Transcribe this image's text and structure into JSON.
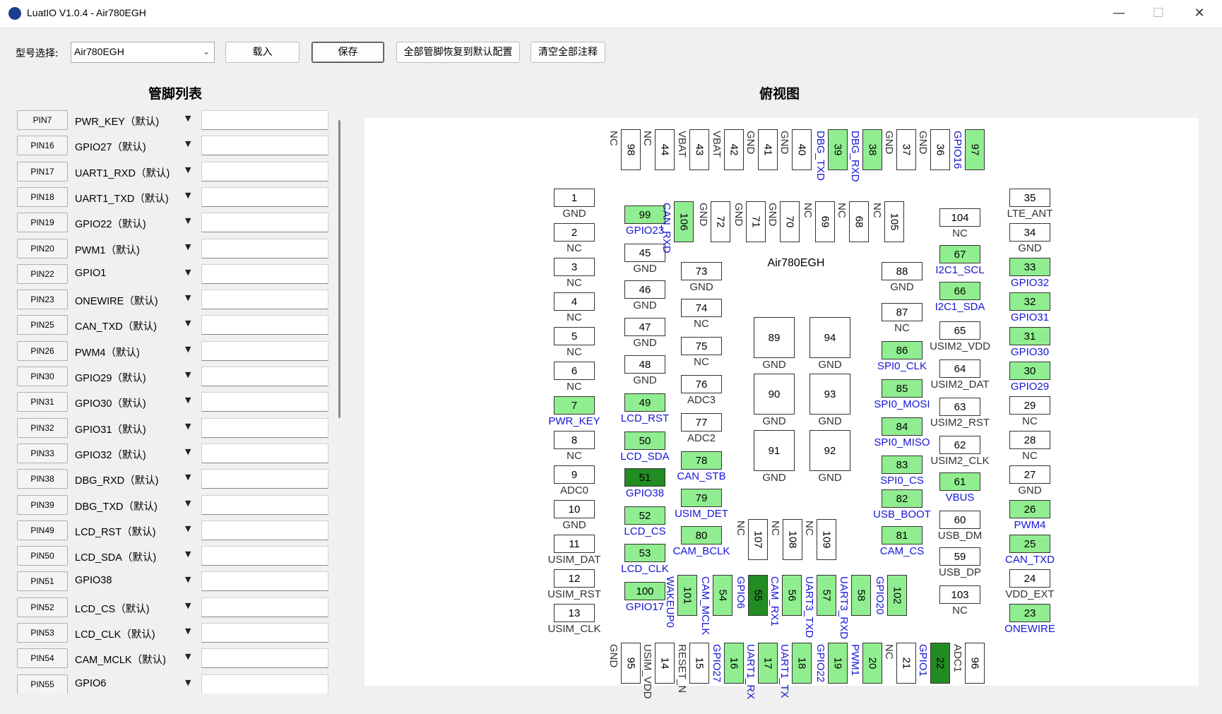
{
  "window": {
    "title": "LuatIO V1.0.4 - Air780EGH",
    "logo_text": "LuatIO"
  },
  "toolbar": {
    "model_label": "型号选择:",
    "model_value": "Air780EGH",
    "load_label": "载入",
    "save_label": "保存",
    "reset_label": "全部管脚恢复到默认配置",
    "clear_label": "清空全部注释"
  },
  "pin_list_title": "管脚列表",
  "top_view_title": "俯视图",
  "chip_name": "Air780EGH",
  "pins": [
    {
      "pin": "PIN7",
      "func": "PWR_KEY（默认)"
    },
    {
      "pin": "PIN16",
      "func": "GPIO27（默认)"
    },
    {
      "pin": "PIN17",
      "func": "UART1_RXD（默认)"
    },
    {
      "pin": "PIN18",
      "func": "UART1_TXD（默认)"
    },
    {
      "pin": "PIN19",
      "func": "GPIO22（默认)"
    },
    {
      "pin": "PIN20",
      "func": "PWM1（默认)"
    },
    {
      "pin": "PIN22",
      "func": "GPIO1"
    },
    {
      "pin": "PIN23",
      "func": "ONEWIRE（默认)"
    },
    {
      "pin": "PIN25",
      "func": "CAN_TXD（默认)"
    },
    {
      "pin": "PIN26",
      "func": "PWM4（默认)"
    },
    {
      "pin": "PIN30",
      "func": "GPIO29（默认)"
    },
    {
      "pin": "PIN31",
      "func": "GPIO30（默认)"
    },
    {
      "pin": "PIN32",
      "func": "GPIO31（默认)"
    },
    {
      "pin": "PIN33",
      "func": "GPIO32（默认)"
    },
    {
      "pin": "PIN38",
      "func": "DBG_RXD（默认)"
    },
    {
      "pin": "PIN39",
      "func": "DBG_TXD（默认)"
    },
    {
      "pin": "PIN49",
      "func": "LCD_RST（默认)"
    },
    {
      "pin": "PIN50",
      "func": "LCD_SDA（默认)"
    },
    {
      "pin": "PIN51",
      "func": "GPIO38"
    },
    {
      "pin": "PIN52",
      "func": "LCD_CS（默认)"
    },
    {
      "pin": "PIN53",
      "func": "LCD_CLK（默认)"
    },
    {
      "pin": "PIN54",
      "func": "CAM_MCLK（默认)"
    },
    {
      "pin": "PIN55",
      "func": "GPIO6"
    }
  ],
  "left_pads": [
    {
      "n": "1",
      "l": "GND",
      "s": ""
    },
    {
      "n": "2",
      "l": "NC",
      "s": ""
    },
    {
      "n": "3",
      "l": "NC",
      "s": ""
    },
    {
      "n": "4",
      "l": "NC",
      "s": ""
    },
    {
      "n": "5",
      "l": "NC",
      "s": ""
    },
    {
      "n": "6",
      "l": "NC",
      "s": ""
    },
    {
      "n": "7",
      "l": "PWR_KEY",
      "s": "green"
    },
    {
      "n": "8",
      "l": "NC",
      "s": ""
    },
    {
      "n": "9",
      "l": "ADC0",
      "s": ""
    },
    {
      "n": "10",
      "l": "GND",
      "s": ""
    },
    {
      "n": "11",
      "l": "USIM_DAT",
      "s": ""
    },
    {
      "n": "12",
      "l": "USIM_RST",
      "s": ""
    },
    {
      "n": "13",
      "l": "USIM_CLK",
      "s": ""
    }
  ],
  "inner_left_pads": [
    {
      "n": "99",
      "l": "GPIO23",
      "s": "green"
    },
    {
      "n": "45",
      "l": "GND",
      "s": ""
    },
    {
      "n": "46",
      "l": "GND",
      "s": ""
    },
    {
      "n": "47",
      "l": "GND",
      "s": ""
    },
    {
      "n": "48",
      "l": "GND",
      "s": ""
    },
    {
      "n": "49",
      "l": "LCD_RST",
      "s": "green"
    },
    {
      "n": "50",
      "l": "LCD_SDA",
      "s": "green"
    },
    {
      "n": "51",
      "l": "GPIO38",
      "s": "dark"
    },
    {
      "n": "52",
      "l": "LCD_CS",
      "s": "green"
    },
    {
      "n": "53",
      "l": "LCD_CLK",
      "s": "green"
    },
    {
      "n": "100",
      "l": "GPIO17",
      "s": "green"
    }
  ],
  "mid_left_pads": [
    {
      "n": "73",
      "l": "GND",
      "s": ""
    },
    {
      "n": "74",
      "l": "NC",
      "s": ""
    },
    {
      "n": "75",
      "l": "NC",
      "s": ""
    },
    {
      "n": "76",
      "l": "ADC3",
      "s": ""
    },
    {
      "n": "77",
      "l": "ADC2",
      "s": ""
    },
    {
      "n": "78",
      "l": "CAN_STB",
      "s": "green"
    },
    {
      "n": "79",
      "l": "USIM_DET",
      "s": "green"
    },
    {
      "n": "80",
      "l": "CAM_BCLK",
      "s": "green"
    }
  ],
  "mid_right_pads": [
    {
      "n": "88",
      "l": "GND",
      "s": ""
    },
    {
      "n": "87",
      "l": "NC",
      "s": ""
    },
    {
      "n": "86",
      "l": "SPI0_CLK",
      "s": "green"
    },
    {
      "n": "85",
      "l": "SPI0_MOSI",
      "s": "green"
    },
    {
      "n": "84",
      "l": "SPI0_MISO",
      "s": "green"
    },
    {
      "n": "83",
      "l": "SPI0_CS",
      "s": "green"
    },
    {
      "n": "82",
      "l": "USB_BOOT",
      "s": "green"
    },
    {
      "n": "81",
      "l": "CAM_CS",
      "s": "green"
    }
  ],
  "inner_right_pads": [
    {
      "n": "104",
      "l": "NC",
      "s": ""
    },
    {
      "n": "67",
      "l": "I2C1_SCL",
      "s": "green"
    },
    {
      "n": "66",
      "l": "I2C1_SDA",
      "s": "green"
    },
    {
      "n": "65",
      "l": "USIM2_VDD",
      "s": ""
    },
    {
      "n": "64",
      "l": "USIM2_DAT",
      "s": ""
    },
    {
      "n": "63",
      "l": "USIM2_RST",
      "s": ""
    },
    {
      "n": "62",
      "l": "USIM2_CLK",
      "s": ""
    },
    {
      "n": "61",
      "l": "VBUS",
      "s": "green"
    },
    {
      "n": "60",
      "l": "USB_DM",
      "s": ""
    },
    {
      "n": "59",
      "l": "USB_DP",
      "s": ""
    },
    {
      "n": "103",
      "l": "NC",
      "s": ""
    }
  ],
  "right_pads": [
    {
      "n": "35",
      "l": "LTE_ANT",
      "s": ""
    },
    {
      "n": "34",
      "l": "GND",
      "s": ""
    },
    {
      "n": "33",
      "l": "GPIO32",
      "s": "green"
    },
    {
      "n": "32",
      "l": "GPIO31",
      "s": "green"
    },
    {
      "n": "31",
      "l": "GPIO30",
      "s": "green"
    },
    {
      "n": "30",
      "l": "GPIO29",
      "s": "green"
    },
    {
      "n": "29",
      "l": "NC",
      "s": ""
    },
    {
      "n": "28",
      "l": "NC",
      "s": ""
    },
    {
      "n": "27",
      "l": "GND",
      "s": ""
    },
    {
      "n": "26",
      "l": "PWM4",
      "s": "green"
    },
    {
      "n": "25",
      "l": "CAN_TXD",
      "s": "green"
    },
    {
      "n": "24",
      "l": "VDD_EXT",
      "s": ""
    },
    {
      "n": "23",
      "l": "ONEWIRE",
      "s": "green"
    }
  ],
  "top_pads": [
    {
      "n": "98",
      "l": "NC",
      "s": ""
    },
    {
      "n": "44",
      "l": "NC",
      "s": ""
    },
    {
      "n": "43",
      "l": "VBAT",
      "s": ""
    },
    {
      "n": "42",
      "l": "VBAT",
      "s": ""
    },
    {
      "n": "41",
      "l": "GND",
      "s": ""
    },
    {
      "n": "40",
      "l": "GND",
      "s": ""
    },
    {
      "n": "39",
      "l": "DBG_TXD",
      "s": "green"
    },
    {
      "n": "38",
      "l": "DBG_RXD",
      "s": "green"
    },
    {
      "n": "37",
      "l": "GND",
      "s": ""
    },
    {
      "n": "36",
      "l": "GND",
      "s": ""
    },
    {
      "n": "97",
      "l": "GPIO16",
      "s": "green"
    }
  ],
  "inner_top_pads": [
    {
      "n": "106",
      "l": "CAN_RXD",
      "s": "green"
    },
    {
      "n": "72",
      "l": "GND",
      "s": ""
    },
    {
      "n": "71",
      "l": "GND",
      "s": ""
    },
    {
      "n": "70",
      "l": "GND",
      "s": ""
    },
    {
      "n": "69",
      "l": "NC",
      "s": ""
    },
    {
      "n": "68",
      "l": "NC",
      "s": ""
    },
    {
      "n": "105",
      "l": "NC",
      "s": ""
    }
  ],
  "inner_bottom_pads": [
    {
      "n": "101",
      "l": "WAKEUP0",
      "s": "green"
    },
    {
      "n": "54",
      "l": "CAM_MCLK",
      "s": "green"
    },
    {
      "n": "55",
      "l": "GPIO6",
      "s": "dark"
    },
    {
      "n": "56",
      "l": "CAM_RX1",
      "s": "green"
    },
    {
      "n": "57",
      "l": "UART3_TXD",
      "s": "green"
    },
    {
      "n": "58",
      "l": "UART3_RXD",
      "s": "green"
    },
    {
      "n": "102",
      "l": "GPIO20",
      "s": "green"
    }
  ],
  "mid_bottom_pads": [
    {
      "n": "107",
      "l": "NC",
      "s": ""
    },
    {
      "n": "108",
      "l": "NC",
      "s": ""
    },
    {
      "n": "109",
      "l": "NC",
      "s": ""
    }
  ],
  "bottom_pads": [
    {
      "n": "95",
      "l": "GND",
      "s": ""
    },
    {
      "n": "14",
      "l": "USIM_VDD",
      "s": ""
    },
    {
      "n": "15",
      "l": "RESET_N",
      "s": ""
    },
    {
      "n": "16",
      "l": "GPIO27",
      "s": "green"
    },
    {
      "n": "17",
      "l": "UART1_RX",
      "s": "green"
    },
    {
      "n": "18",
      "l": "UART1_TX",
      "s": "green"
    },
    {
      "n": "19",
      "l": "GPIO22",
      "s": "green"
    },
    {
      "n": "20",
      "l": "PWM1",
      "s": "green"
    },
    {
      "n": "21",
      "l": "NC",
      "s": ""
    },
    {
      "n": "22",
      "l": "GPIO1",
      "s": "dark"
    },
    {
      "n": "96",
      "l": "ADC1",
      "s": ""
    }
  ],
  "center_pads": [
    {
      "n": "89",
      "l": "GND"
    },
    {
      "n": "94",
      "l": "GND"
    },
    {
      "n": "90",
      "l": "GND"
    },
    {
      "n": "93",
      "l": "GND"
    },
    {
      "n": "91",
      "l": "GND"
    },
    {
      "n": "92",
      "l": "GND"
    }
  ],
  "colors": {
    "active": "#90ee90",
    "modified": "#228b22",
    "label_blue": "#1515d8"
  }
}
